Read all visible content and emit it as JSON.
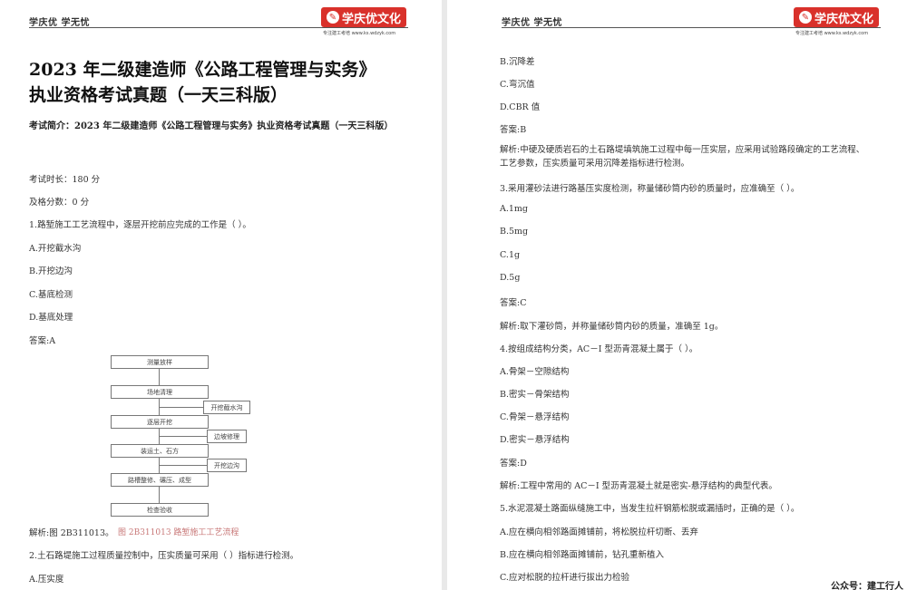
{
  "header": {
    "left_text": "学庆优 学无忧",
    "brand_name": "学庆优文化",
    "brand_sub": "专注建工考培 www.ks.wdzyk.com"
  },
  "left": {
    "title_line1": "2023 年二级建造师《公路工程管理与实务》",
    "title_line2": "执业资格考试真题（一天三科版）",
    "intro": "考试简介：2023 年二级建造师《公路工程管理与实务》执业资格考试真题（一天三科版）",
    "duration": "考试时长：180 分",
    "pass_score": "及格分数：0 分",
    "q1": "1.路堑施工工艺流程中，逐层开挖前应完成的工作是（     ）。",
    "q1_a": "A.开挖截水沟",
    "q1_b": "B.开挖边沟",
    "q1_c": "C.基底检测",
    "q1_d": "D.基底处理",
    "q1_answer": "答案:A",
    "flowchart": {
      "main": [
        "测量放样",
        "场地清理",
        "逐层开挖",
        "装运土、石方",
        "路槽整修、碾压、成型",
        "检查验收"
      ],
      "side": [
        "开挖截水沟",
        "边坡修理",
        "开挖边沟"
      ]
    },
    "q1_analysis": "解析:图 2B311013。",
    "figure_caption": "图 2B311013   路堑施工工艺流程",
    "q2": "2.土石路堤施工过程质量控制中，压实质量可采用（     ）指标进行检测。",
    "q2_a": "A.压实度"
  },
  "right": {
    "q2_b": "B.沉降差",
    "q2_c": "C.弯沉值",
    "q2_d": "D.CBR 值",
    "q2_answer": "答案:B",
    "q2_analysis": "解析:中硬及硬质岩石的土石路堤填筑施工过程中每一压实层，应采用试验路段确定的工艺流程、工艺参数，压实质量可采用沉降差指标进行检测。",
    "q3": "3.采用灌砂法进行路基压实度检测，称量储砂筒内砂的质量时，应准确至（     ）。",
    "q3_a": "A.1mg",
    "q3_b": "B.5mg",
    "q3_c": "C.1g",
    "q3_d": "D.5g",
    "q3_answer": "答案:C",
    "q3_analysis": "解析:取下灌砂筒，并称量储砂筒内砂的质量，准确至 1g。",
    "q4": "4.按组成结构分类，AC－I 型沥青混凝土属于（     ）。",
    "q4_a": "A.骨架－空隙结构",
    "q4_b": "B.密实－骨架结构",
    "q4_c": "C.骨架－悬浮结构",
    "q4_d": "D.密实－悬浮结构",
    "q4_answer": "答案:D",
    "q4_analysis": "解析:工程中常用的 AC－I 型沥青混凝土就是密实-悬浮结构的典型代表。",
    "q5": "5.水泥混凝土路面纵缝施工中，当发生拉杆钢筋松脱或漏插时，正确的是（     ）。",
    "q5_a": "A.应在横向相邻路面摊铺前，将松脱拉杆切断、丢弃",
    "q5_b": "B.应在横向相邻路面摊铺前，钻孔重新植入",
    "q5_c": "C.应对松脱的拉杆进行拔出力检验"
  },
  "watermark": "公众号：建工行人",
  "colors": {
    "brand": "#d9312b",
    "caption": "#c87878"
  }
}
